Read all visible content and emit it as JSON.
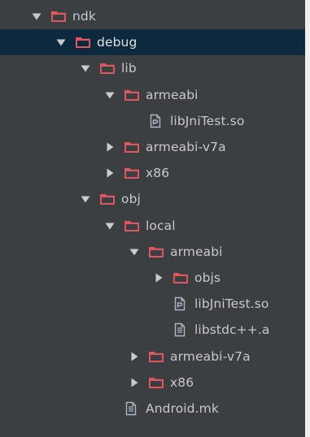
{
  "colors": {
    "panel_background": "#3c3f41",
    "selected_row": "#0d293e",
    "folder_icon": "#e0565e",
    "file_icon": "#a9b7c6",
    "arrow": "#c9cbcd",
    "text": "#c7c9cc"
  },
  "tree": {
    "items": [
      {
        "label": "ndk",
        "depth": 0,
        "kind": "folder",
        "expanded": true,
        "selected": false,
        "icon": "folder-icon"
      },
      {
        "label": "debug",
        "depth": 1,
        "kind": "folder",
        "expanded": true,
        "selected": true,
        "icon": "folder-icon"
      },
      {
        "label": "lib",
        "depth": 2,
        "kind": "folder",
        "expanded": true,
        "selected": false,
        "icon": "folder-icon"
      },
      {
        "label": "armeabi",
        "depth": 3,
        "kind": "folder",
        "expanded": true,
        "selected": false,
        "icon": "folder-icon"
      },
      {
        "label": "libJniTest.so",
        "depth": 4,
        "kind": "file",
        "selected": false,
        "icon": "binary-file-icon"
      },
      {
        "label": "armeabi-v7a",
        "depth": 3,
        "kind": "folder",
        "expanded": false,
        "selected": false,
        "icon": "folder-icon"
      },
      {
        "label": "x86",
        "depth": 3,
        "kind": "folder",
        "expanded": false,
        "selected": false,
        "icon": "folder-icon"
      },
      {
        "label": "obj",
        "depth": 2,
        "kind": "folder",
        "expanded": true,
        "selected": false,
        "icon": "folder-icon"
      },
      {
        "label": "local",
        "depth": 3,
        "kind": "folder",
        "expanded": true,
        "selected": false,
        "icon": "folder-icon"
      },
      {
        "label": "armeabi",
        "depth": 4,
        "kind": "folder",
        "expanded": true,
        "selected": false,
        "icon": "folder-icon"
      },
      {
        "label": "objs",
        "depth": 5,
        "kind": "folder",
        "expanded": false,
        "selected": false,
        "icon": "folder-icon"
      },
      {
        "label": "libJniTest.so",
        "depth": 5,
        "kind": "file",
        "selected": false,
        "icon": "binary-file-icon"
      },
      {
        "label": "libstdc++.a",
        "depth": 5,
        "kind": "file",
        "selected": false,
        "icon": "text-file-icon"
      },
      {
        "label": "armeabi-v7a",
        "depth": 4,
        "kind": "folder",
        "expanded": false,
        "selected": false,
        "icon": "folder-icon"
      },
      {
        "label": "x86",
        "depth": 4,
        "kind": "folder",
        "expanded": false,
        "selected": false,
        "icon": "folder-icon"
      },
      {
        "label": "Android.mk",
        "depth": 3,
        "kind": "file",
        "selected": false,
        "icon": "text-file-icon"
      }
    ]
  }
}
